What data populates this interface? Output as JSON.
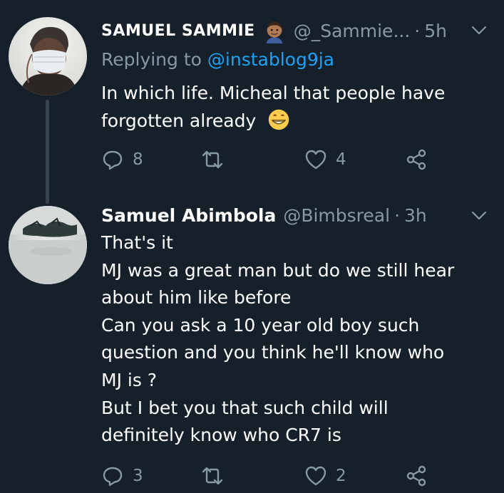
{
  "colors": {
    "background": "#15202b",
    "primary_text": "#ffffff",
    "secondary_text": "#8899a6",
    "link": "#1da1f2",
    "thread_line": "#38444d"
  },
  "tweets": [
    {
      "name": "SAMUEL SAMMIE",
      "name_emoji": "man-medium-skin-emoji",
      "handle": "@_Sammie...",
      "separator": "·",
      "time": "5h",
      "replying_to_label": "Replying to",
      "replying_to_handle": "@instablog9ja",
      "body_lines": [
        "In which life. Micheal that people have",
        "forgotten already"
      ],
      "body_emoji": "grinning-face-emoji",
      "replies": "8",
      "retweets": "",
      "likes": "4",
      "icons": [
        "reply-icon",
        "retweet-icon",
        "like-icon",
        "share-icon",
        "caret-down-icon"
      ]
    },
    {
      "name": "Samuel Abimbola",
      "handle": "@Bimbsreal",
      "separator": "·",
      "time": "3h",
      "body_lines": [
        "That's it",
        "MJ was a great man but do we still hear",
        "about him like before",
        "Can you ask a 10 year old boy such",
        "question and you think he'll know who",
        "MJ is ?",
        "But I bet you that such child will",
        "definitely know who CR7 is"
      ],
      "replies": "3",
      "retweets": "",
      "likes": "2",
      "icons": [
        "reply-icon",
        "retweet-icon",
        "like-icon",
        "share-icon",
        "caret-down-icon"
      ]
    }
  ]
}
